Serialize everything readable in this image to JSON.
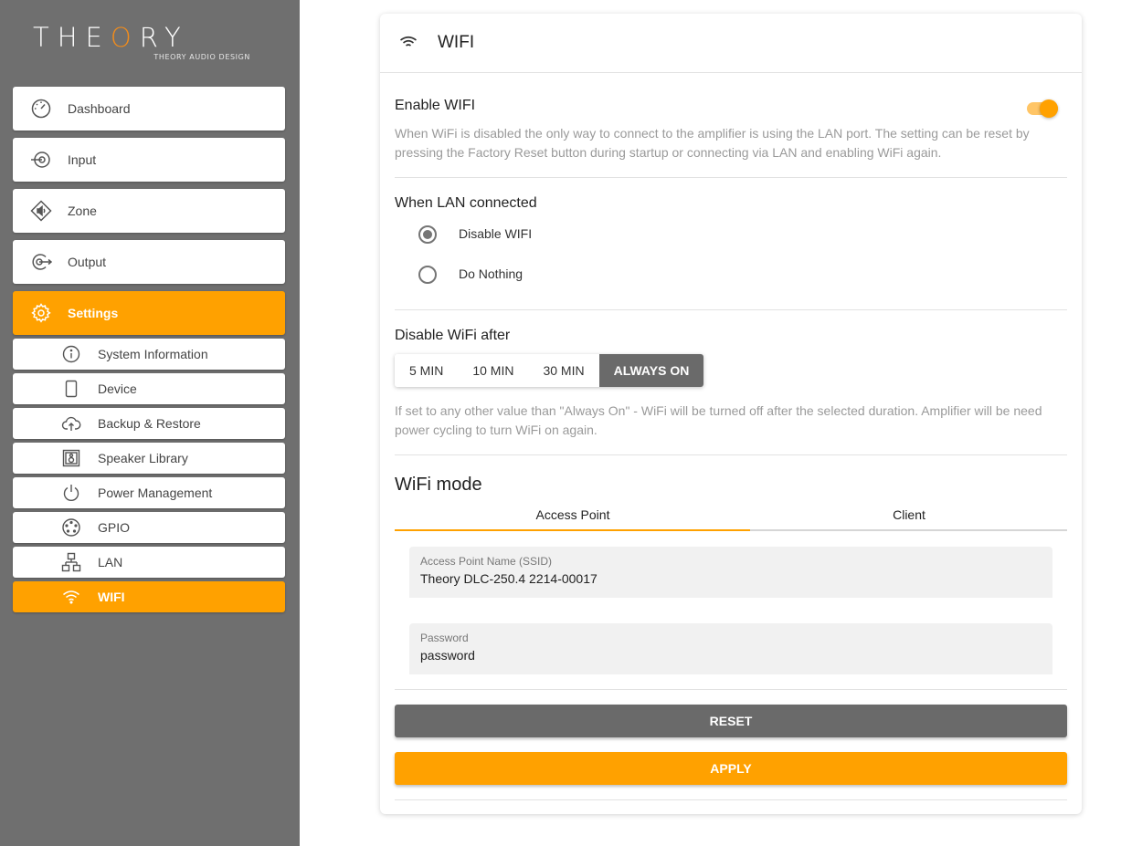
{
  "brand": {
    "logo_prefix": "THE",
    "logo_o": "O",
    "logo_suffix": "RY",
    "logo_sub": "THEORY AUDIO DESIGN",
    "accent_color": "#ffa100",
    "sidebar_color": "#6f6f6f"
  },
  "sidebar": {
    "main_items": [
      {
        "label": "Dashboard",
        "icon": "gauge-icon"
      },
      {
        "label": "Input",
        "icon": "input-icon"
      },
      {
        "label": "Zone",
        "icon": "zone-speaker-icon"
      },
      {
        "label": "Output",
        "icon": "output-icon"
      },
      {
        "label": "Settings",
        "icon": "gear-icon",
        "active": true
      }
    ],
    "sub_items": [
      {
        "label": "System Information",
        "icon": "info-icon"
      },
      {
        "label": "Device",
        "icon": "device-icon"
      },
      {
        "label": "Backup & Restore",
        "icon": "cloud-upload-icon"
      },
      {
        "label": "Speaker Library",
        "icon": "speaker-icon"
      },
      {
        "label": "Power Management",
        "icon": "power-icon"
      },
      {
        "label": "GPIO",
        "icon": "gpio-connector-icon"
      },
      {
        "label": "LAN",
        "icon": "network-icon"
      },
      {
        "label": "WIFI",
        "icon": "wifi-icon",
        "active": true
      }
    ]
  },
  "card": {
    "title": "WIFI",
    "enable": {
      "title": "Enable WIFI",
      "enabled": true,
      "description": "When WiFi is disabled the only way to connect to the amplifier is using the LAN port. The setting can be reset by pressing the Factory Reset button during startup or connecting via LAN and enabling WiFi again."
    },
    "lan": {
      "title": "When LAN connected",
      "options": [
        "Disable WIFI",
        "Do Nothing"
      ],
      "selected": "Disable WIFI"
    },
    "disable_after": {
      "title": "Disable WiFi after",
      "options": [
        "5 MIN",
        "10 MIN",
        "30 MIN",
        "ALWAYS ON"
      ],
      "selected": "ALWAYS ON",
      "description": "If set to any other value than \"Always On\" - WiFi will be turned off after the selected duration. Amplifier will be need power cycling to turn WiFi on again."
    },
    "mode": {
      "title": "WiFi mode",
      "tabs": [
        "Access Point",
        "Client"
      ],
      "active_tab": "Access Point",
      "ssid_label": "Access Point Name (SSID)",
      "ssid_value": "Theory DLC-250.4 2214-00017",
      "password_label": "Password",
      "password_value": "password"
    },
    "buttons": {
      "reset": "RESET",
      "apply": "APPLY"
    }
  }
}
